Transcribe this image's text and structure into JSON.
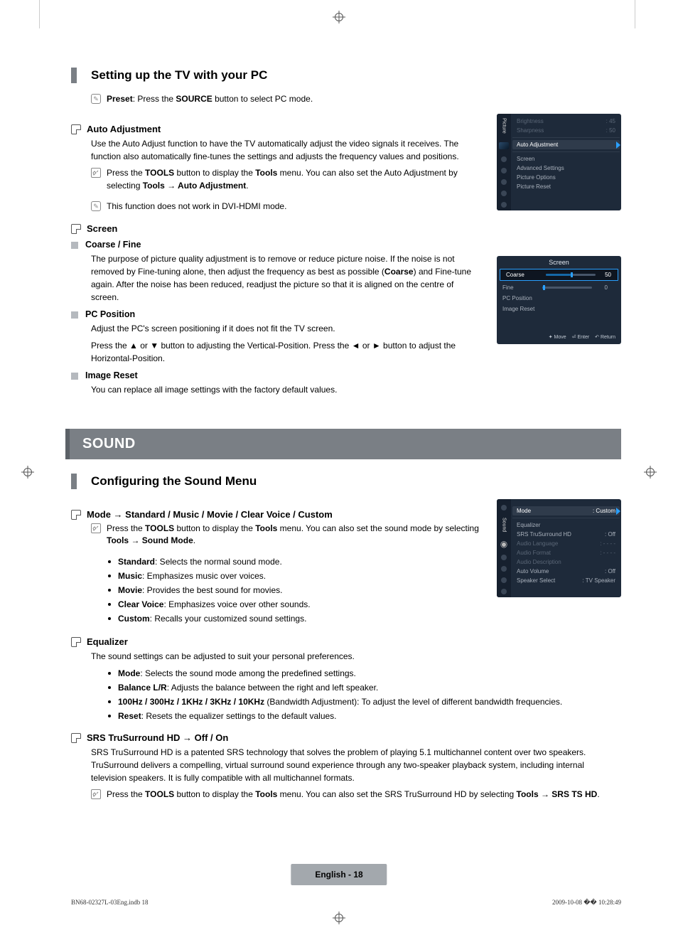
{
  "section1": {
    "title": "Setting up the TV with your PC",
    "preset_note": "Preset: Press the SOURCE button to select PC mode.",
    "sub1": {
      "title": "Auto Adjustment",
      "body": "Use the Auto Adjust function to have the TV automatically adjust the video signals it receives. The function also automatically fine-tunes the settings and adjusts the frequency values and positions.",
      "tool_note": "Press the TOOLS button to display the Tools menu. You can also set the Auto Adjustment by selecting Tools → Auto Adjustment.",
      "info_note": "This function does not work in DVI-HDMI mode."
    },
    "sub2": {
      "title": "Screen",
      "item1": {
        "title": "Coarse / Fine",
        "body": "The purpose of picture quality adjustment is to remove or reduce picture noise. If the noise is not removed by Fine-tuning alone, then adjust the frequency as best as possible (Coarse) and Fine-tune again. After the noise has been reduced, readjust the picture so that it is aligned on the centre of screen."
      },
      "item2": {
        "title": "PC Position",
        "body1": "Adjust the PC's screen positioning if it does not fit the TV screen.",
        "body2": "Press the ▲ or ▼ button to adjusting the Vertical-Position. Press the ◄ or ► button to adjust the Horizontal-Position."
      },
      "item3": {
        "title": "Image Reset",
        "body": "You can replace all image settings with the factory default values."
      }
    }
  },
  "banner": "SOUND",
  "section2": {
    "title": "Configuring the Sound Menu",
    "sub1": {
      "title": "Mode → Standard / Music / Movie / Clear Voice / Custom",
      "tool_note": "Press the TOOLS button to display the Tools menu. You can also set the sound mode by selecting Tools → Sound Mode.",
      "bullets": {
        "b1": "Standard: Selects the normal sound mode.",
        "b2": "Music: Emphasizes music over voices.",
        "b3": "Movie: Provides the best sound for movies.",
        "b4": "Clear Voice: Emphasizes voice over other sounds.",
        "b5": "Custom: Recalls your customized sound settings."
      }
    },
    "sub2": {
      "title": "Equalizer",
      "body": "The sound settings can be adjusted to suit your personal preferences.",
      "bullets": {
        "b1": "Mode: Selects the sound mode among the predefined settings.",
        "b2": "Balance L/R: Adjusts the balance between the right and left speaker.",
        "b3": "100Hz / 300Hz / 1KHz / 3KHz / 10KHz (Bandwidth Adjustment): To adjust the level of different bandwidth frequencies.",
        "b4": "Reset: Resets the equalizer settings to the default values."
      }
    },
    "sub3": {
      "title": "SRS TruSurround HD → Off / On",
      "body": "SRS TruSurround HD is a patented SRS technology that solves the problem of playing 5.1 multichannel content over two speakers. TruSurround delivers a compelling, virtual surround sound experience through any two-speaker playback system, including internal television speakers. It is fully compatible with all multichannel formats.",
      "tool_note": "Press the TOOLS button to display the Tools menu. You can also set the SRS TruSurround HD by selecting Tools → SRS TS HD."
    }
  },
  "picture_menu": {
    "tab": "Picture",
    "brightness_label": "Brightness",
    "brightness_val": ": 45",
    "sharpness_label": "Sharpness",
    "sharpness_val": ": 50",
    "auto_adj": "Auto Adjustment",
    "items": {
      "i1": "Screen",
      "i2": "Advanced Settings",
      "i3": "Picture Options",
      "i4": "Picture Reset"
    }
  },
  "screen_menu": {
    "title": "Screen",
    "coarse": "Coarse",
    "coarse_val": "50",
    "fine": "Fine",
    "fine_val": "0",
    "pc_pos": "PC Position",
    "image_reset": "Image Reset",
    "f_move": "Move",
    "f_enter": "Enter",
    "f_return": "Return"
  },
  "sound_menu": {
    "tab": "Sound",
    "mode": "Mode",
    "mode_val": ": Custom",
    "items": {
      "eq": "Equalizer",
      "srs": "SRS TruSurround HD",
      "srs_val": ": Off",
      "audio_lang": "Audio Language",
      "audio_lang_val": ": - - - -",
      "audio_format": "Audio Format",
      "audio_format_val": ": - - - -",
      "audio_desc": "Audio Description",
      "auto_vol": "Auto Volume",
      "auto_vol_val": ": Off",
      "speaker": "Speaker Select",
      "speaker_val": ": TV Speaker"
    }
  },
  "page_badge": "English - 18",
  "footer": {
    "left": "BN68-02327L-03Eng.indb   18",
    "right": "2009-10-08   �� 10:28:49"
  }
}
